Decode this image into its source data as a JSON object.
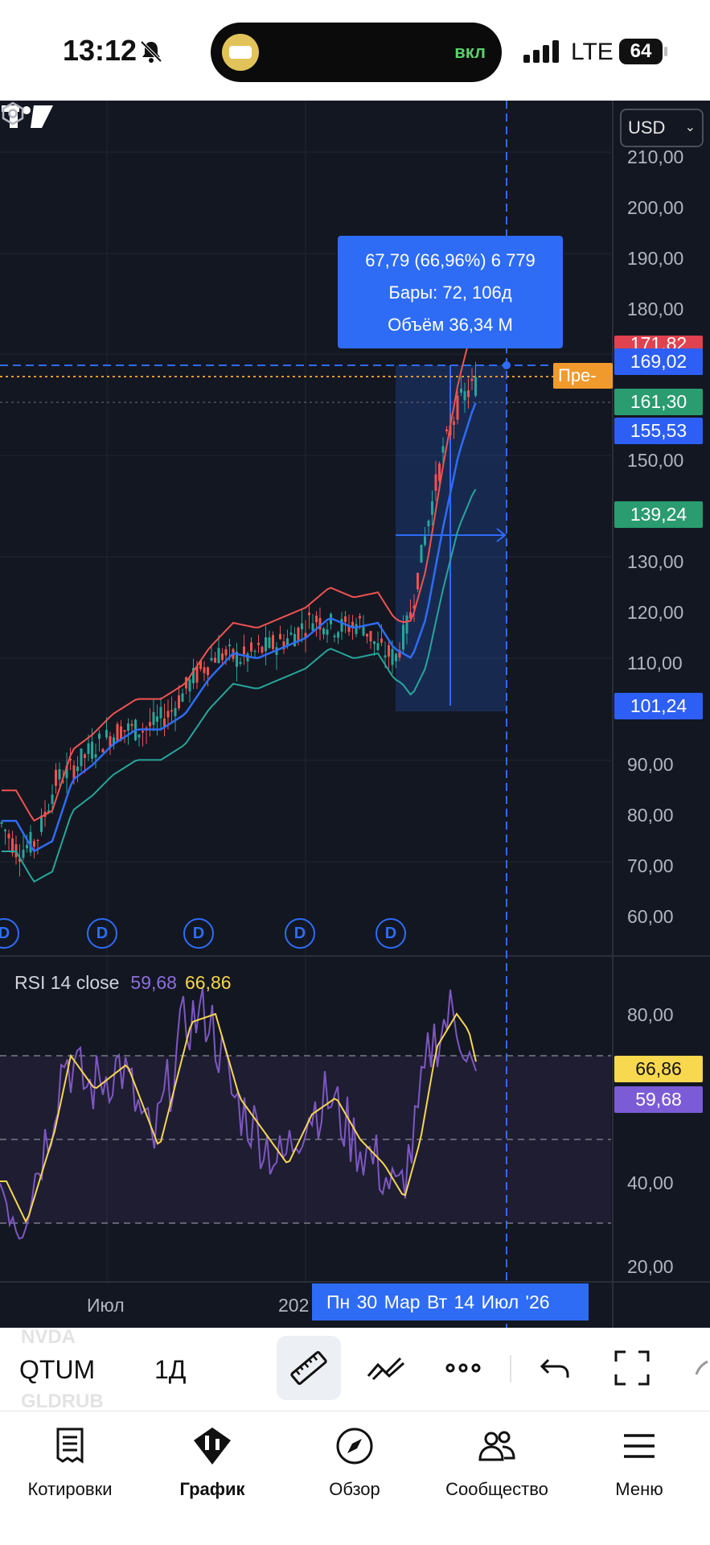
{
  "status_bar": {
    "time": "13:12",
    "island_text": "вкл",
    "network": "LTE",
    "battery": "64",
    "icons": [
      "bell-slash-icon",
      "app-icon",
      "signal-icon",
      "battery-icon"
    ]
  },
  "chart": {
    "currency": "USD",
    "price_axis": [
      "210,00",
      "200,00",
      "190,00",
      "180,00",
      "150,00",
      "130,00",
      "120,00",
      "110,00",
      "90,00",
      "80,00",
      "70,00",
      "60,00"
    ],
    "badges": {
      "high": "171,82",
      "crosshair": "169,02",
      "upper": "161,30",
      "last": "155,53",
      "lower": "139,24",
      "range_low": "101,24"
    },
    "premarket_label": "Пре-",
    "measure": {
      "line1": "67,79 (66,96%) 6 779",
      "line2": "Бары: 72, 106д",
      "line3": "Объём 36,34 M"
    },
    "dividend_marker": "D",
    "rsi": {
      "title": "RSI 14 close",
      "value1": "59,68",
      "value2": "66,86",
      "axis": [
        "80,00",
        "40,00",
        "20,00"
      ],
      "badge_yellow": "66,86",
      "badge_purple": "59,68"
    },
    "time_axis": {
      "jul": "Июл",
      "year_partial": "202",
      "range_label": "Пн 30 Мар   Вт 14 Июл '26"
    },
    "colors": {
      "background": "#131722",
      "accent_blue": "#2e6cf6",
      "candle_up": "#26a69a",
      "candle_down": "#ef5350",
      "rsi_line": "#7e57c2",
      "rsi_ma": "#f7d64f"
    }
  },
  "toolbar": {
    "ghost_symbol_top": "NVDA",
    "symbol": "QTUM",
    "ghost_symbol_bottom": "GLDRUB",
    "interval": "1Д",
    "icons": [
      "ruler-icon",
      "drawing-tools-icon",
      "more-icon",
      "undo-icon",
      "fullscreen-icon"
    ]
  },
  "bottom_nav": {
    "items": [
      {
        "label": "Котировки",
        "icon": "quotes-icon"
      },
      {
        "label": "График",
        "icon": "chart-icon"
      },
      {
        "label": "Обзор",
        "icon": "compass-icon"
      },
      {
        "label": "Сообщество",
        "icon": "community-icon"
      },
      {
        "label": "Меню",
        "icon": "menu-icon"
      }
    ]
  }
}
